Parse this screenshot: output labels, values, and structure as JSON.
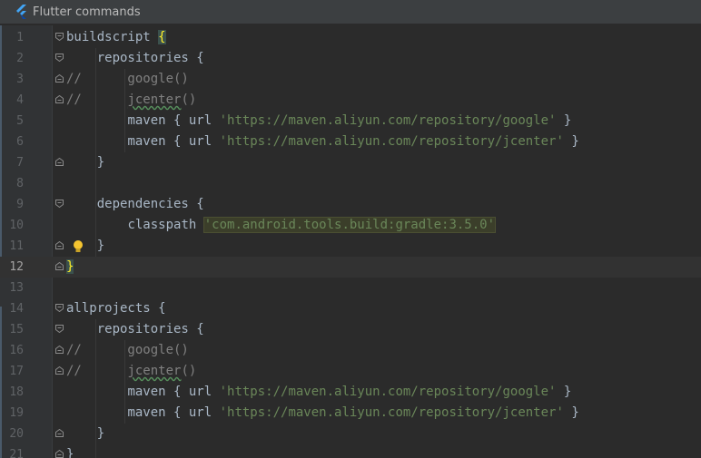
{
  "banner": {
    "title": "Flutter commands",
    "icon": "flutter-logo-icon"
  },
  "editor": {
    "current_line": 12,
    "lines": [
      {
        "num": "1",
        "indent": "",
        "tokens": [
          {
            "t": "buildscript "
          },
          {
            "t": "{",
            "k": "brace-hl"
          }
        ],
        "fold": "open"
      },
      {
        "num": "2",
        "indent": "    ",
        "tokens": [
          {
            "t": "repositories {"
          }
        ],
        "fold": "open"
      },
      {
        "num": "3",
        "indent": "",
        "tokens": [
          {
            "t": "//",
            "k": "cmt"
          },
          {
            "t": "      google()",
            "k": "cmt"
          }
        ],
        "fold": "close"
      },
      {
        "num": "4",
        "indent": "",
        "tokens": [
          {
            "t": "//",
            "k": "cmt"
          },
          {
            "t": "      ",
            "k": "cmt"
          },
          {
            "t": "jcenter",
            "k": "cmt-squig"
          },
          {
            "t": "()",
            "k": "cmt"
          }
        ],
        "fold": "close"
      },
      {
        "num": "5",
        "indent": "        ",
        "tokens": [
          {
            "t": "maven { url "
          },
          {
            "t": "'https://maven.aliyun.com/repository/google'",
            "k": "str"
          },
          {
            "t": " }"
          }
        ],
        "fold": ""
      },
      {
        "num": "6",
        "indent": "        ",
        "tokens": [
          {
            "t": "maven { url "
          },
          {
            "t": "'https://maven.aliyun.com/repository/jcenter'",
            "k": "str"
          },
          {
            "t": " }"
          }
        ],
        "fold": ""
      },
      {
        "num": "7",
        "indent": "    ",
        "tokens": [
          {
            "t": "}"
          }
        ],
        "fold": "close"
      },
      {
        "num": "8",
        "indent": "",
        "tokens": [],
        "fold": ""
      },
      {
        "num": "9",
        "indent": "    ",
        "tokens": [
          {
            "t": "dependencies {"
          }
        ],
        "fold": "open"
      },
      {
        "num": "10",
        "indent": "        ",
        "tokens": [
          {
            "t": "classpath "
          },
          {
            "t": "'com.android.tools.build:gradle:3.5.0'",
            "k": "str-hl"
          }
        ],
        "fold": ""
      },
      {
        "num": "11",
        "indent": "    ",
        "tokens": [
          {
            "t": "}"
          }
        ],
        "fold": "close",
        "bulb": true
      },
      {
        "num": "12",
        "indent": "",
        "tokens": [
          {
            "t": "}",
            "k": "brace-hl"
          }
        ],
        "fold": "close"
      },
      {
        "num": "13",
        "indent": "",
        "tokens": [],
        "fold": ""
      },
      {
        "num": "14",
        "indent": "",
        "tokens": [
          {
            "t": "allprojects {"
          }
        ],
        "fold": "open"
      },
      {
        "num": "15",
        "indent": "    ",
        "tokens": [
          {
            "t": "repositories {"
          }
        ],
        "fold": "open"
      },
      {
        "num": "16",
        "indent": "",
        "tokens": [
          {
            "t": "//",
            "k": "cmt"
          },
          {
            "t": "      google()",
            "k": "cmt"
          }
        ],
        "fold": "close"
      },
      {
        "num": "17",
        "indent": "",
        "tokens": [
          {
            "t": "//",
            "k": "cmt"
          },
          {
            "t": "      ",
            "k": "cmt"
          },
          {
            "t": "jcenter",
            "k": "cmt-squig"
          },
          {
            "t": "()",
            "k": "cmt"
          }
        ],
        "fold": "close"
      },
      {
        "num": "18",
        "indent": "        ",
        "tokens": [
          {
            "t": "maven { url "
          },
          {
            "t": "'https://maven.aliyun.com/repository/google'",
            "k": "str"
          },
          {
            "t": " }"
          }
        ],
        "fold": ""
      },
      {
        "num": "19",
        "indent": "        ",
        "tokens": [
          {
            "t": "maven { url "
          },
          {
            "t": "'https://maven.aliyun.com/repository/jcenter'",
            "k": "str"
          },
          {
            "t": " }"
          }
        ],
        "fold": ""
      },
      {
        "num": "20",
        "indent": "    ",
        "tokens": [
          {
            "t": "}"
          }
        ],
        "fold": "close"
      },
      {
        "num": "21",
        "indent": "",
        "tokens": [
          {
            "t": "}"
          }
        ],
        "fold": "close"
      }
    ]
  },
  "colors": {
    "background": "#2b2b2b",
    "gutter": "#313335",
    "keyword_text": "#a9b7c6",
    "string": "#6a8759",
    "comment": "#808080",
    "line_number": "#606366",
    "brace_match": "#ffef28",
    "flutter_blue": "#42a5f5"
  }
}
